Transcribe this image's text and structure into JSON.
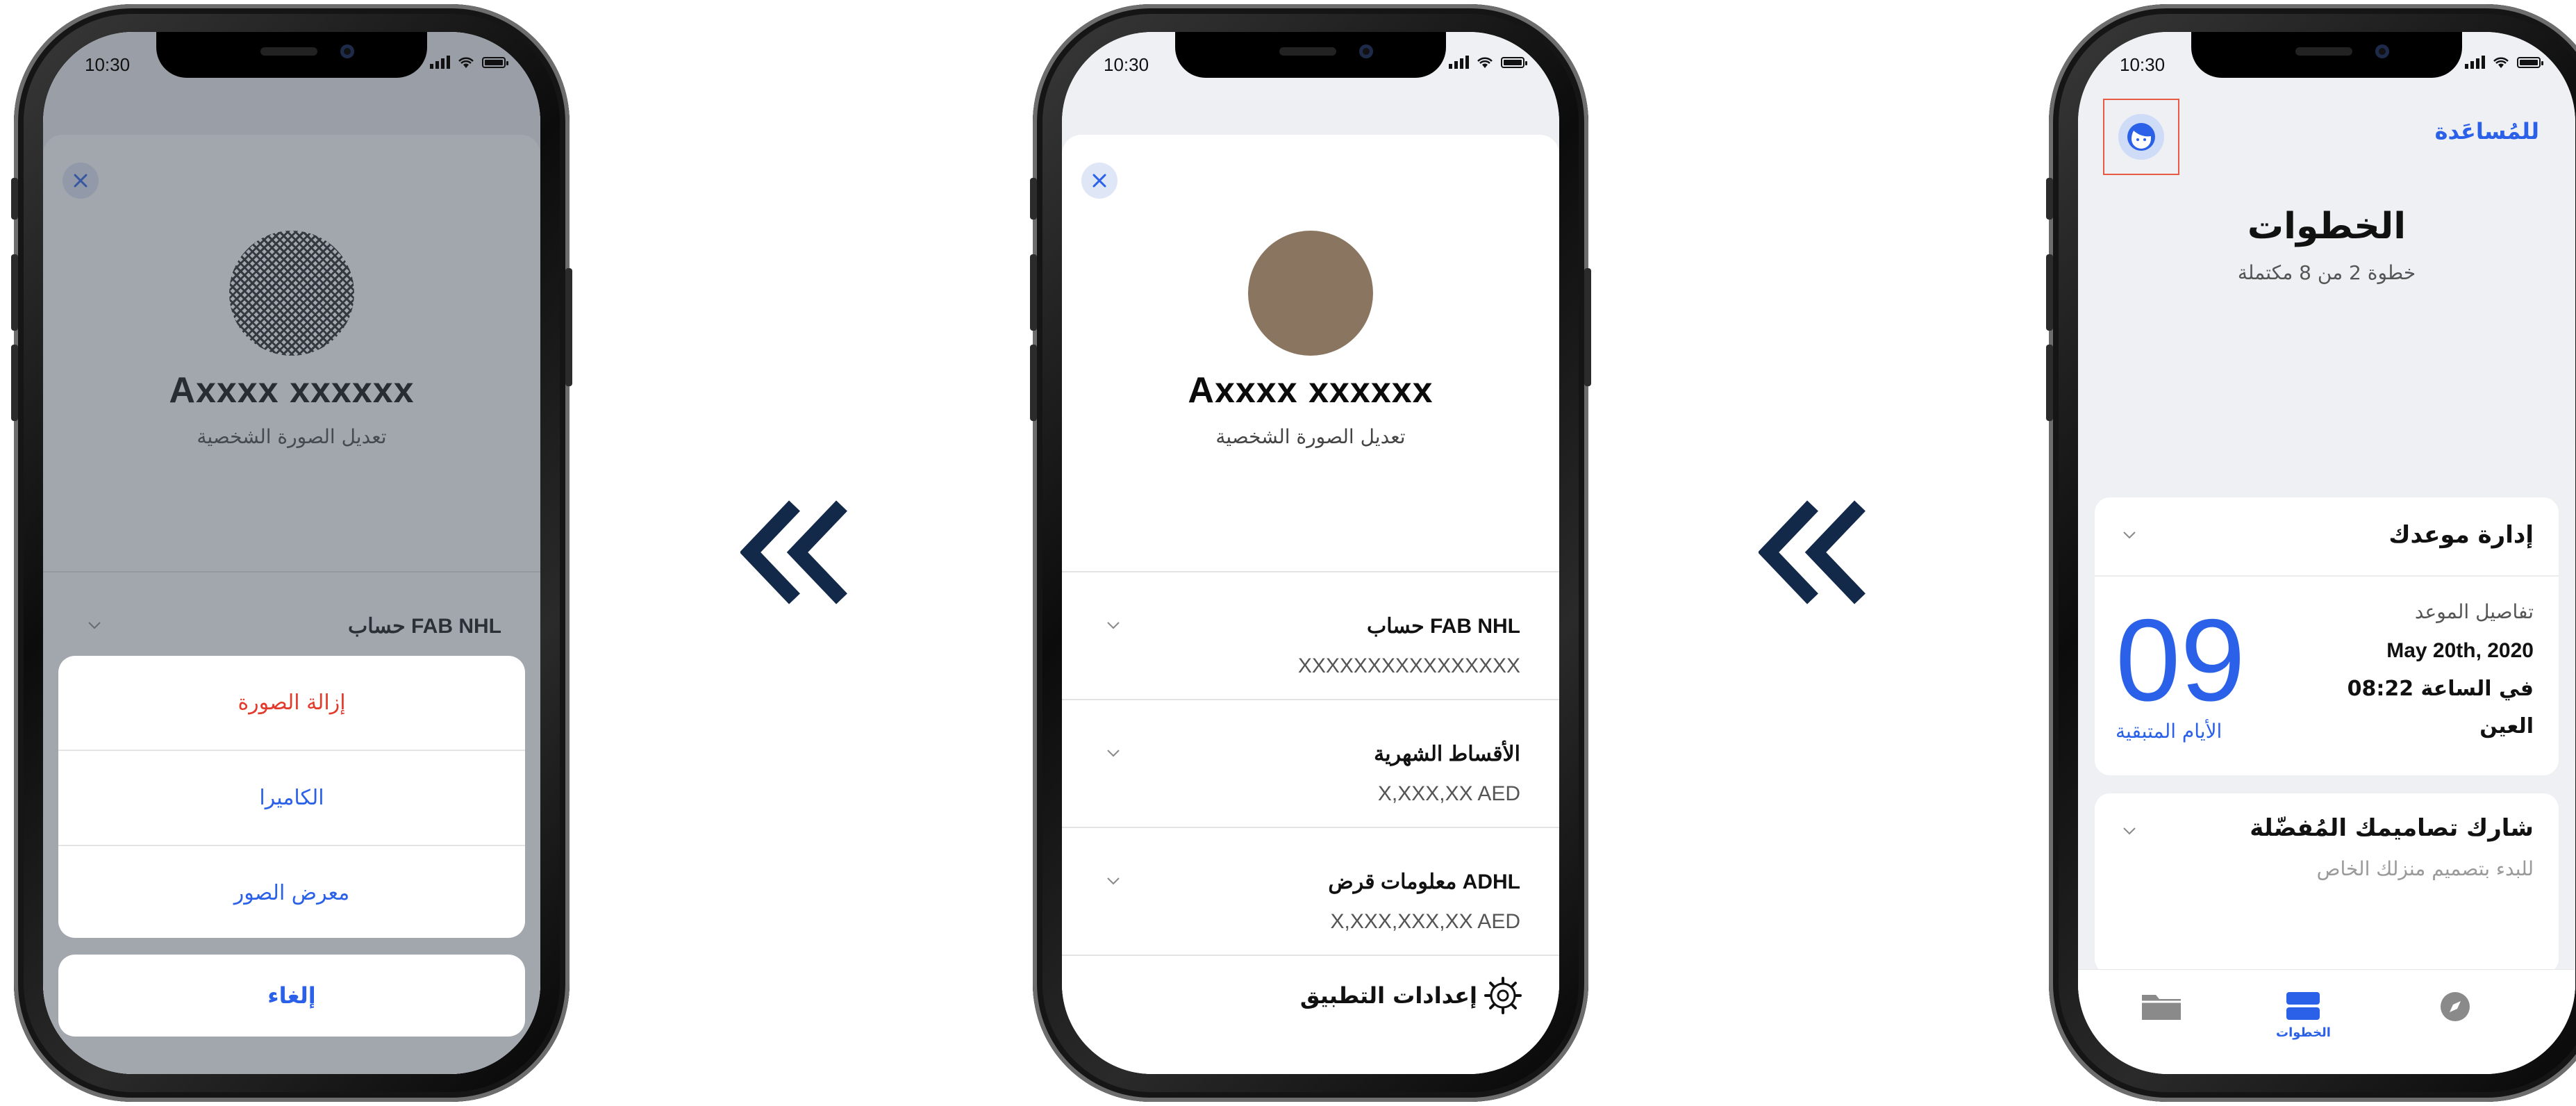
{
  "status_bar": {
    "time": "10:30"
  },
  "profile": {
    "name": "Axxxx xxxxxx",
    "edit_photo_label": "تعديل الصورة الشخصية",
    "avatar_color": "#8a7660",
    "rows": [
      {
        "title": "حساب FAB NHL",
        "value": "XXXXXXXXXXXXXXXX"
      },
      {
        "title": "الأقساط الشهرية",
        "value": "X,XXX,XX AED"
      },
      {
        "title": "معلومات قرض ADHL",
        "value": "X,XXX,XXX,XX AED"
      }
    ],
    "settings_label": "إعدادات التطبيق"
  },
  "photo_actions": {
    "remove": "إزالة الصورة",
    "camera": "الكاميرا",
    "gallery": "معرض الصور",
    "cancel": "إلغاء"
  },
  "steps_screen": {
    "help_link": "للمُساعَدة",
    "title": "الخطوات",
    "subtitle": "خطوة 2 من 8 مكتملة",
    "appointment_card": {
      "title": "إدارة موعدك",
      "days_number": "09",
      "days_label": "الأيام المتبقية",
      "details_label": "تفاصيل الموعد",
      "date": "May 20th, 2020",
      "time": "في الساعة 08:22",
      "location": "العين"
    },
    "share_card": {
      "title": "شارك تصاميمك المُفضّلة",
      "subtitle": "للبدء بتصميم منزلك الخاص"
    },
    "tabs": [
      {
        "label": "",
        "icon": "folder-icon"
      },
      {
        "label": "الخطوات",
        "icon": "steps-icon"
      },
      {
        "label": "",
        "icon": "compass-icon"
      }
    ]
  },
  "colors": {
    "accent": "#2a61e8",
    "danger": "#e23a2b",
    "navy_arrow": "#12294a",
    "highlight": "#e85a43"
  }
}
